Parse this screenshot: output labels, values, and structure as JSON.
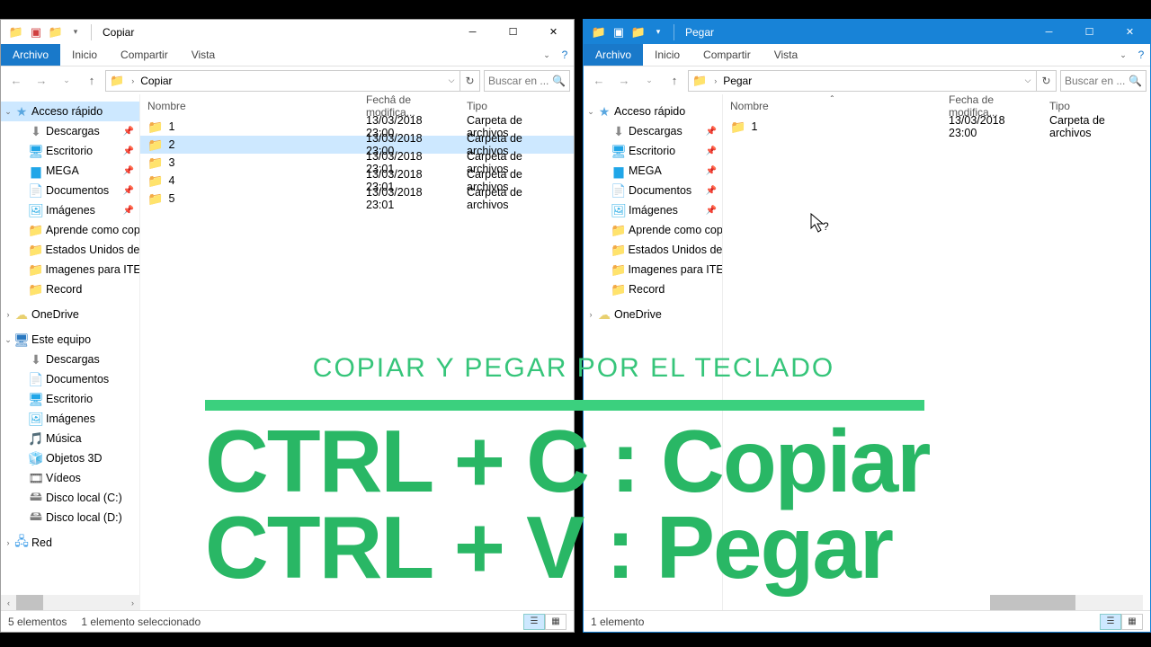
{
  "left": {
    "title": "Copiar",
    "ribbon": {
      "file": "Archivo",
      "home": "Inicio",
      "share": "Compartir",
      "view": "Vista"
    },
    "breadcrumb": "Copiar",
    "search_placeholder": "Buscar en ...",
    "columns": {
      "name": "Nombre",
      "date": "Fecha de modifica...",
      "type": "Tipo"
    },
    "rows": [
      {
        "name": "1",
        "date": "13/03/2018 23:00",
        "type": "Carpeta de archivos",
        "selected": false
      },
      {
        "name": "2",
        "date": "13/03/2018 23:00",
        "type": "Carpeta de archivos",
        "selected": true
      },
      {
        "name": "3",
        "date": "13/03/2018 23:01",
        "type": "Carpeta de archivos",
        "selected": false
      },
      {
        "name": "4",
        "date": "13/03/2018 23:01",
        "type": "Carpeta de archivos",
        "selected": false
      },
      {
        "name": "5",
        "date": "13/03/2018 23:01",
        "type": "Carpeta de archivos",
        "selected": false
      }
    ],
    "status": {
      "count": "5 elementos",
      "selected": "1 elemento seleccionado"
    }
  },
  "right": {
    "title": "Pegar",
    "ribbon": {
      "file": "Archivo",
      "home": "Inicio",
      "share": "Compartir",
      "view": "Vista"
    },
    "breadcrumb": "Pegar",
    "search_placeholder": "Buscar en ...",
    "columns": {
      "name": "Nombre",
      "date": "Fecha de modifica...",
      "type": "Tipo"
    },
    "rows": [
      {
        "name": "1",
        "date": "13/03/2018 23:00",
        "type": "Carpeta de archivos",
        "selected": false
      }
    ],
    "status": {
      "count": "1 elemento"
    }
  },
  "tree": {
    "quick": "Acceso rápido",
    "downloads": "Descargas",
    "desktop": "Escritorio",
    "mega": "MEGA",
    "documents": "Documentos",
    "images": "Imágenes",
    "f1": "Aprende como cop",
    "f2": "Estados Unidos desp",
    "f3": "Imagenes para ITEC",
    "f4": "Record",
    "onedrive": "OneDrive",
    "thispc": "Este equipo",
    "pc_downloads": "Descargas",
    "pc_documents": "Documentos",
    "pc_desktop": "Escritorio",
    "pc_images": "Imágenes",
    "pc_music": "Música",
    "pc_3d": "Objetos 3D",
    "pc_videos": "Vídeos",
    "pc_c": "Disco local (C:)",
    "pc_d": "Disco local (D:)",
    "network": "Red"
  },
  "overlay": {
    "heading": "COPIAR Y PEGAR POR EL TECLADO",
    "line1": "CTRL + C : Copiar",
    "line2": "CTRL + V : Pegar"
  }
}
